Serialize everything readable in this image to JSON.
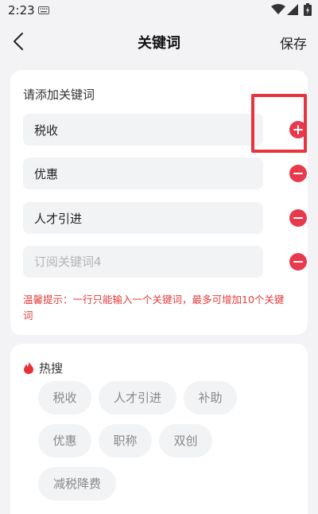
{
  "status_bar": {
    "time": "2:23"
  },
  "header": {
    "title": "关键词",
    "save_label": "保存"
  },
  "keywords_card": {
    "section_label": "请添加关键词",
    "rows": [
      {
        "value": "税收",
        "placeholder": "",
        "action": "add"
      },
      {
        "value": "优惠",
        "placeholder": "",
        "action": "remove"
      },
      {
        "value": "人才引进",
        "placeholder": "",
        "action": "remove"
      },
      {
        "value": "",
        "placeholder": "订阅关键词4",
        "action": "remove"
      }
    ],
    "hint": "温馨提示：一行只能输入一个关键词，最多可增加10个关键词"
  },
  "hot_card": {
    "title": "热搜",
    "tags": [
      "税收",
      "人才引进",
      "补助",
      "优惠",
      "职称",
      "双创",
      "减税降费"
    ]
  },
  "colors": {
    "accent_red": "#e83a4c",
    "hint_red": "#e23a3a",
    "highlight_border": "#e8343f"
  },
  "icons": [
    "keyboard-icon",
    "wifi-icon",
    "signal-icon",
    "battery-icon",
    "back-arrow-icon",
    "plus-circle-icon",
    "minus-circle-icon",
    "fire-icon"
  ]
}
